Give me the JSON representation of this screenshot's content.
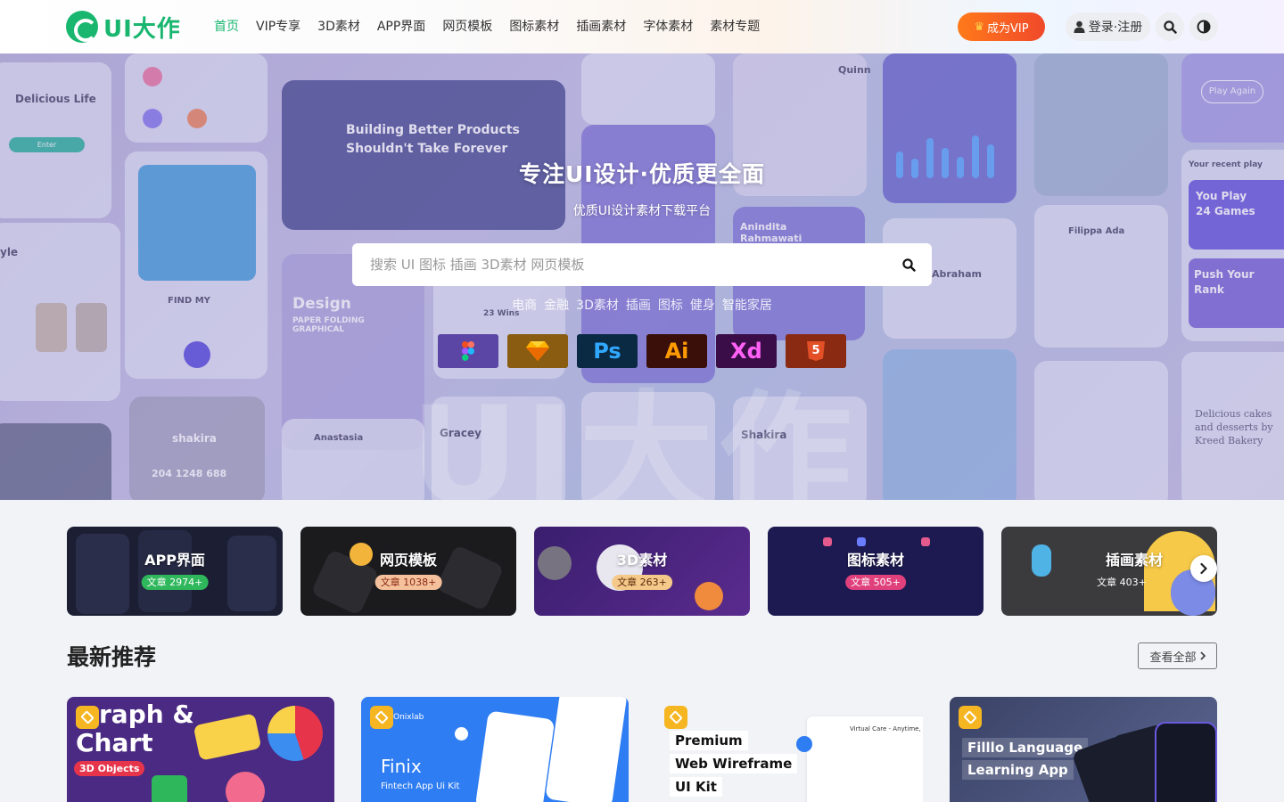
{
  "header": {
    "logo_text": "UI大作",
    "nav": [
      "首页",
      "VIP专享",
      "3D素材",
      "APP界面",
      "网页模板",
      "图标素材",
      "插画素材",
      "字体素材",
      "素材专题"
    ],
    "active_nav": 0,
    "vip_label": "成为VIP",
    "login_label": "登录·注册",
    "colors": {
      "brand": "#18b66f",
      "vip": "#f0492a"
    }
  },
  "hero": {
    "title": "专注UI设计·优质更全面",
    "subtitle": "优质UI设计素材下载平台",
    "search_placeholder": "搜索 UI 图标 插画 3D素材 网页模板",
    "hot_tags": [
      "电商",
      "金融",
      "3D素材",
      "插画",
      "图标",
      "健身",
      "智能家居"
    ],
    "tools": [
      {
        "icon": "figma-icon",
        "label": ""
      },
      {
        "icon": "sketch-icon",
        "label": ""
      },
      {
        "icon": "photoshop-icon",
        "label": "Ps"
      },
      {
        "icon": "illustrator-icon",
        "label": "Ai"
      },
      {
        "icon": "xd-icon",
        "label": "Xd"
      },
      {
        "icon": "html5-icon",
        "label": "5"
      }
    ],
    "background_texts": {
      "delicious_life": "Delicious Life",
      "enter": "Enter",
      "building": "Building Better Products Shouldn't Take Forever",
      "find_my": "FIND MY",
      "design": "Design",
      "paper_folding": "PAPER FOLDING GRAPHICAL",
      "wins": "23 Wins",
      "anastasia": "Anastasia",
      "shakira_top": "shakira",
      "stats": "204  1248  688",
      "gracey": "Gracey",
      "shakira": "Shakira",
      "anindita": "Anindita Rahmawati",
      "abraham": "Abraham",
      "filippa": "Filippa Ada",
      "play_again": "Play Again",
      "your_recent_play": "Your recent play",
      "you_play": "You Play 24 Games",
      "push_rank": "Push Your Rank",
      "delicious_cakes": "Delicious cakes and desserts by Kreed Bakery",
      "quinn": "Quinn",
      "yle": "yle"
    }
  },
  "categories": [
    {
      "title": "APP界面",
      "count": "文章 2974+"
    },
    {
      "title": "网页模板",
      "count": "文章 1038+"
    },
    {
      "title": "3D素材",
      "count": "文章 263+"
    },
    {
      "title": "图标素材",
      "count": "文章 505+"
    },
    {
      "title": "插画素材",
      "count": "文章 403+"
    }
  ],
  "latest": {
    "title": "最新推荐",
    "view_all": "查看全部",
    "cards": [
      {
        "line1": "raph &",
        "line2": "Chart",
        "tag": "3D Objects"
      },
      {
        "brand": "Onixlab",
        "title": "Finix",
        "subtitle": "Fintech App Ui Kit"
      },
      {
        "line1": "Premium",
        "line2": "Web Wireframe",
        "line3": "UI Kit",
        "right_text": "Virtual Care - Anytime,"
      },
      {
        "line1": "Filllo Language",
        "line2": "Learning App"
      }
    ]
  }
}
